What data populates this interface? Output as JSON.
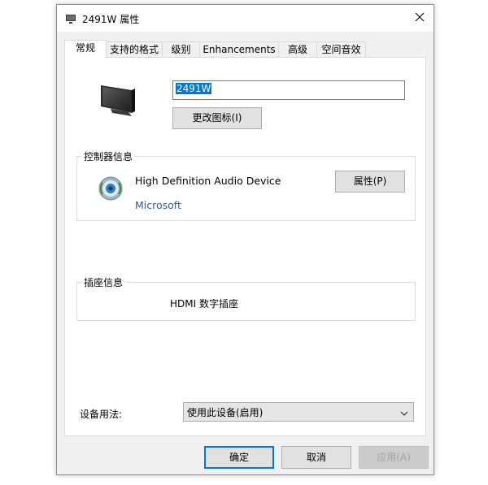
{
  "window": {
    "title": "2491W 属性",
    "icons": {
      "title": "speaker-monitor-icon",
      "close": "close-icon"
    }
  },
  "tabs": [
    {
      "label": "常规",
      "active": true
    },
    {
      "label": "支持的格式",
      "active": false
    },
    {
      "label": "级别",
      "active": false
    },
    {
      "label": "Enhancements",
      "active": false
    },
    {
      "label": "高级",
      "active": false
    },
    {
      "label": "空间音效",
      "active": false
    }
  ],
  "general": {
    "device_icon": "monitor-icon",
    "name_value": "2491W",
    "change_icon_label": "更改图标(I)",
    "controller": {
      "group_label": "控制器信息",
      "icon": "audio-device-icon",
      "device_name": "High Definition Audio Device",
      "manufacturer": "Microsoft",
      "properties_label": "属性(P)"
    },
    "jack": {
      "group_label": "插座信息",
      "value": "HDMI 数字插座"
    },
    "usage": {
      "label": "设备用法:",
      "selected": "使用此设备(启用)"
    }
  },
  "footer": {
    "ok_label": "确定",
    "cancel_label": "取消",
    "apply_label": "应用(A)"
  },
  "colors": {
    "accent": "#0078d7",
    "link": "#3a5a8c",
    "disabled_text": "#a0a0a0"
  }
}
